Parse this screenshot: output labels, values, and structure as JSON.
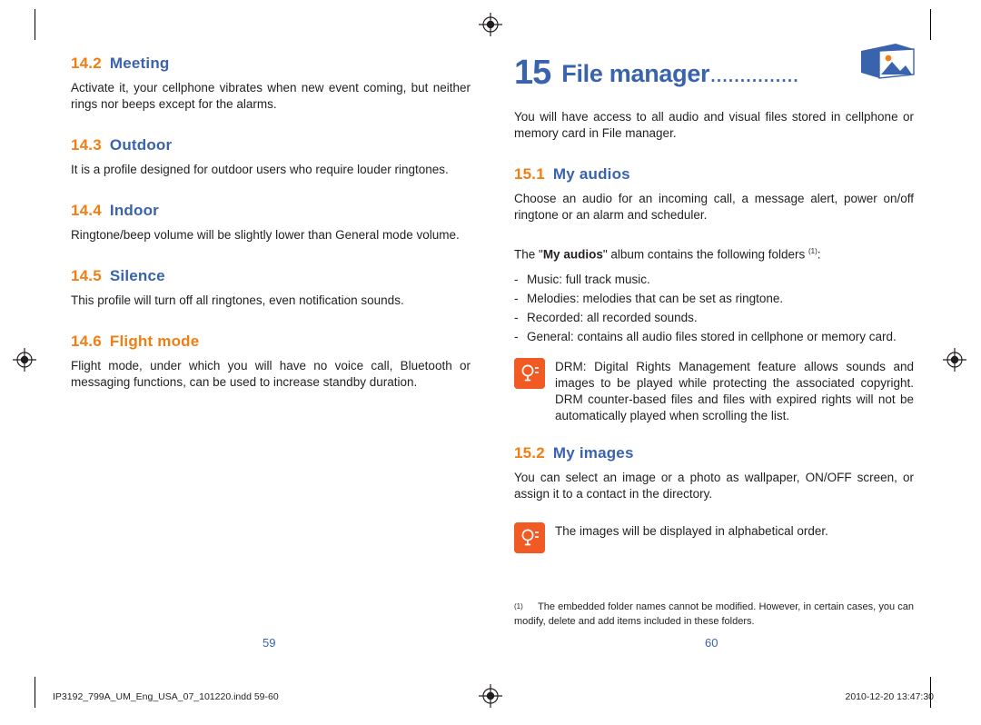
{
  "left_page": {
    "sections": [
      {
        "num": "14.2",
        "title": "Meeting",
        "body": "Activate it, your cellphone vibrates when new event coming, but neither rings nor beeps except for the alarms."
      },
      {
        "num": "14.3",
        "title": "Outdoor",
        "body": "It is a profile designed for outdoor users who require louder ringtones."
      },
      {
        "num": "14.4",
        "title": "Indoor",
        "body": "Ringtone/beep volume will be slightly lower than General mode volume."
      },
      {
        "num": "14.5",
        "title": "Silence",
        "body": "This profile will turn off all ringtones, even notification sounds."
      },
      {
        "num": "14.6",
        "title": "Flight mode",
        "body": "Flight mode, under which you will have no voice call, Bluetooth or messaging functions, can be used to increase standby duration."
      }
    ],
    "folio": "59"
  },
  "right_page": {
    "chapter": {
      "number": "15",
      "title": "File manager",
      "dots": "...............",
      "icon": "picture-file-icon"
    },
    "intro": "You will have access to all audio and visual files stored in cellphone or memory card in File manager.",
    "sections": [
      {
        "num": "15.1",
        "title": "My audios",
        "body": "Choose an audio for an incoming call, a message alert, power on/off ringtone or an alarm and scheduler.",
        "lead_pre": "The \"",
        "lead_quoted": "My audios",
        "lead_post": "\" album contains the following folders ",
        "lead_sup": "(1)",
        "lead_end": ":",
        "items": [
          "Music: full track music.",
          "Melodies: melodies that can be set as ringtone.",
          "Recorded: all recorded sounds.",
          "General: contains all audio files stored in cellphone or memory card."
        ],
        "note": "DRM: Digital Rights Management feature allows sounds and images to be played while protecting the associated copyright. DRM counter-based files and files with expired rights will not be automatically played when scrolling the list."
      },
      {
        "num": "15.2",
        "title": "My images",
        "body": "You can select an image or a photo as wallpaper, ON/OFF screen, or assign it to a contact in the directory.",
        "note": "The images will be displayed in alphabetical order."
      }
    ],
    "footnote": {
      "mark": "(1)",
      "text": "The embedded folder names cannot be modified. However, in certain cases, you can modify, delete and add items included in these folders."
    },
    "folio": "60"
  },
  "footer": {
    "filename": "IP3192_799A_UM_Eng_USA_07_101220.indd   59-60",
    "timestamp": "2010-12-20   13:47:30"
  },
  "colors": {
    "heading_number": "#f07f13",
    "heading_title": "#3a63ad",
    "chapter": "#3a63ad",
    "note_icon": "#f15a22",
    "folio": "#3a63ad"
  }
}
